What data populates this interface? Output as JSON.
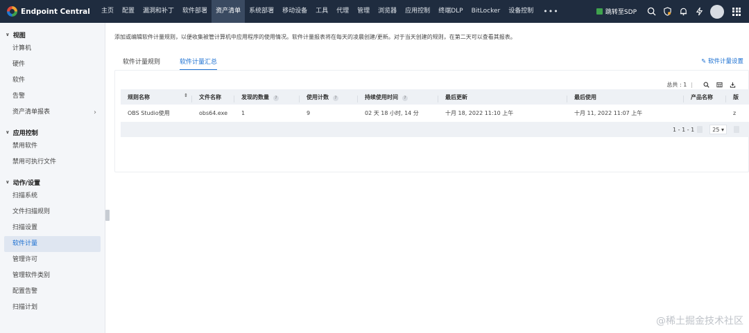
{
  "app": {
    "brand": "Endpoint Central"
  },
  "nav": {
    "items": [
      "主页",
      "配置",
      "漏洞和补丁",
      "软件部署",
      "资产清单",
      "系统部署",
      "移动设备",
      "工具",
      "代理",
      "管理",
      "浏览器",
      "应用控制",
      "终端DLP",
      "BitLocker",
      "设备控制"
    ],
    "active_index": 4,
    "more": "•••",
    "sdp_link": "跳转至SDP"
  },
  "sidebar": {
    "sections": [
      {
        "title": "视图",
        "items": [
          {
            "label": "计算机"
          },
          {
            "label": "硬件"
          },
          {
            "label": "软件"
          },
          {
            "label": "告警"
          },
          {
            "label": "资产清单报表",
            "arrow": "›"
          }
        ]
      },
      {
        "title": "应用控制",
        "items": [
          {
            "label": "禁用软件"
          },
          {
            "label": "禁用可执行文件"
          }
        ]
      },
      {
        "title": "动作/设置",
        "items": [
          {
            "label": "扫描系统"
          },
          {
            "label": "文件扫描规则"
          },
          {
            "label": "扫描设置"
          },
          {
            "label": "软件计量",
            "active": true
          },
          {
            "label": "管理许可"
          },
          {
            "label": "管理软件类别"
          },
          {
            "label": "配置告警"
          },
          {
            "label": "扫描计划"
          }
        ]
      }
    ]
  },
  "main": {
    "description": "添加或编辑软件计量规则，以便收集被管计算机中应用程序的使用情况。软件计量报表将在每天的凌晨创建/更新。对于当天创建的规则，在第二天可以查看其报表。",
    "tabs": [
      "软件计量规则",
      "软件计量汇总"
    ],
    "active_tab": 1,
    "settings_link": "✎ 软件计量设置",
    "total": "总共 : 1",
    "table": {
      "columns": [
        "规则名称",
        "文件名称",
        "发现的数量",
        "使用计数",
        "持续使用时间",
        "最后更新",
        "最后使用",
        "产品名称",
        "版"
      ],
      "rows": [
        [
          "OBS Studio使用",
          "obs64.exe",
          "1",
          "9",
          "02 天 18 小时, 14 分",
          "十月 18, 2022 11:10 上午",
          "十月 11, 2022 11:07 上午",
          "",
          "z"
        ]
      ],
      "range": "1 - 1 - 1",
      "page_size": "25 ▾"
    }
  },
  "watermark": "@稀土掘金技术社区",
  "colors": {
    "topbar": "#1f2c3f",
    "accent": "#1a6fd1",
    "sidebar_bg": "#f4f6f9"
  }
}
